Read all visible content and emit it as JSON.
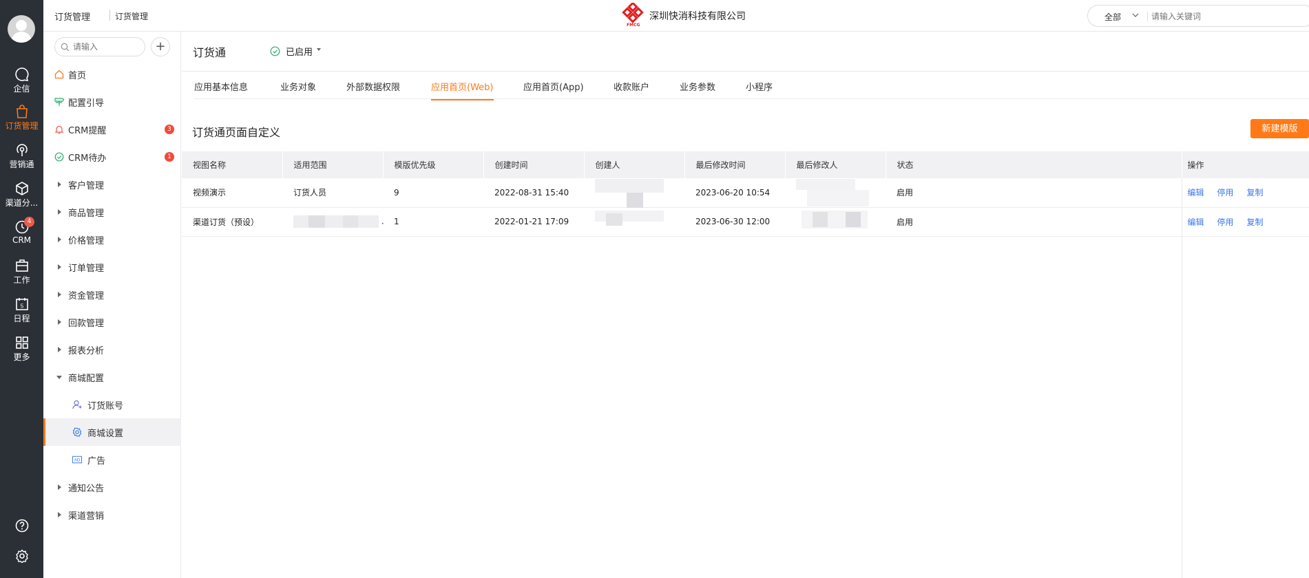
{
  "rail": {
    "items": [
      {
        "label": "企信",
        "icon": "chat-bubble-icon"
      },
      {
        "label": "订货管理",
        "icon": "shopping-bag-icon",
        "active": true
      },
      {
        "label": "营销通",
        "icon": "broadcast-icon"
      },
      {
        "label": "渠道分...",
        "icon": "cube-icon"
      },
      {
        "label": "CRM",
        "icon": "clock-icon",
        "badge": "4"
      },
      {
        "label": "工作",
        "icon": "briefcase-icon"
      },
      {
        "label": "日程",
        "icon": "calendar-icon",
        "day": "5"
      },
      {
        "label": "更多",
        "icon": "grid-icon"
      }
    ]
  },
  "header": {
    "crumb_primary": "订货管理",
    "crumb_secondary": "订货管理",
    "company_name": "深圳快消科技有限公司",
    "logo_text": "FMCG",
    "search_scope": "全部",
    "search_placeholder": "请输入关键词"
  },
  "sidebar": {
    "search_placeholder": "请输入",
    "add_label": "+",
    "items": [
      {
        "label": "首页",
        "icon": "home-icon"
      },
      {
        "label": "配置引导",
        "icon": "signpost-icon"
      },
      {
        "label": "CRM提醒",
        "icon": "bell-icon",
        "badge": "3"
      },
      {
        "label": "CRM待办",
        "icon": "check-circle-icon",
        "badge": "1"
      },
      {
        "label": "客户管理",
        "icon": "expand-arrow-icon"
      },
      {
        "label": "商品管理",
        "icon": "expand-arrow-icon"
      },
      {
        "label": "价格管理",
        "icon": "expand-arrow-icon"
      },
      {
        "label": "订单管理",
        "icon": "expand-arrow-icon"
      },
      {
        "label": "资金管理",
        "icon": "expand-arrow-icon"
      },
      {
        "label": "回款管理",
        "icon": "expand-arrow-icon"
      },
      {
        "label": "报表分析",
        "icon": "expand-arrow-icon"
      },
      {
        "label": "商城配置",
        "icon": "collapse-arrow-icon"
      },
      {
        "label": "订货账号",
        "icon": "user-account-icon"
      },
      {
        "label": "商城设置",
        "icon": "gear-icon",
        "selected": true
      },
      {
        "label": "广告",
        "icon": "ad-icon"
      },
      {
        "label": "通知公告",
        "icon": "expand-arrow-icon"
      },
      {
        "label": "渠道营销",
        "icon": "expand-arrow-icon"
      }
    ]
  },
  "main": {
    "app_title": "订货通",
    "status_label": "已启用",
    "tabs": [
      "应用基本信息",
      "业务对象",
      "外部数据权限",
      "应用首页(Web)",
      "应用首页(App)",
      "收款账户",
      "业务参数",
      "小程序"
    ],
    "active_tab": "应用首页(Web)",
    "section_title": "订货通页面自定义",
    "new_button": "新建模版",
    "table": {
      "columns": [
        "视图名称",
        "适用范围",
        "模版优先级",
        "创建时间",
        "创建人",
        "最后修改时间",
        "最后修改人",
        "状态",
        "操作"
      ],
      "rows": [
        {
          "name": "视频演示",
          "scope": "订货人员",
          "priority": "9",
          "created": "2022-08-31 15:40",
          "modified": "2023-06-20 10:54",
          "status": "启用"
        },
        {
          "name": "渠道订货（预设）",
          "scope": ".",
          "priority": "1",
          "created": "2022-01-21 17:09",
          "modified": "2023-06-30 12:00",
          "status": "启用"
        }
      ],
      "actions": [
        "编辑",
        "停用",
        "复制"
      ]
    }
  },
  "colors": {
    "accent": "#ff7a17",
    "link": "#3b78e7",
    "rail_bg": "#2b2f36",
    "badge": "#f04b3a"
  }
}
